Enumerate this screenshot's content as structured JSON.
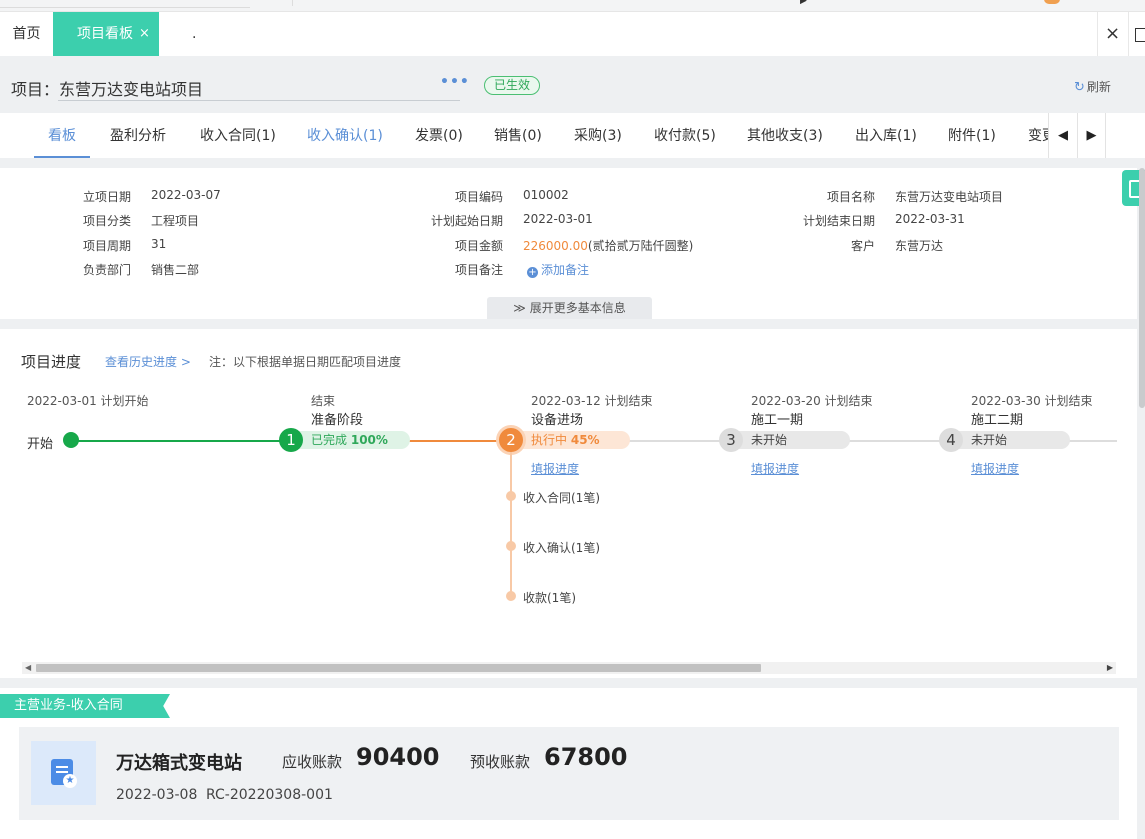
{
  "tabs": {
    "home": "首页",
    "active": "项目看板",
    "active_close": "×",
    "extra": ".",
    "close_all": "×"
  },
  "project": {
    "label": "项目：",
    "name": "东营万达变电站项目",
    "more": "•••",
    "status": "已生效",
    "refresh": "刷新"
  },
  "nav": {
    "items": [
      {
        "label": "看板"
      },
      {
        "label": "盈利分析"
      },
      {
        "label": "收入合同(1)"
      },
      {
        "label": "收入确认(1)"
      },
      {
        "label": "发票(0)"
      },
      {
        "label": "销售(0)"
      },
      {
        "label": "采购(3)"
      },
      {
        "label": "收付款(5)"
      },
      {
        "label": "其他收支(3)"
      },
      {
        "label": "出入库(1)"
      },
      {
        "label": "附件(1)"
      },
      {
        "label": "变更"
      }
    ]
  },
  "info": {
    "col1": [
      {
        "label": "立项日期",
        "value": "2022-03-07"
      },
      {
        "label": "项目分类",
        "value": "工程项目"
      },
      {
        "label": "项目周期",
        "value": "31"
      },
      {
        "label": "负责部门",
        "value": "销售二部"
      }
    ],
    "col2": [
      {
        "label": "项目编码",
        "value": "010002"
      },
      {
        "label": "计划起始日期",
        "value": "2022-03-01"
      },
      {
        "label": "项目金额",
        "value": "226000.00",
        "extra": "(贰拾贰万陆仟圆整)"
      },
      {
        "label": "项目备注",
        "value": "添加备注"
      }
    ],
    "col3": [
      {
        "label": "项目名称",
        "value": "东营万达变电站项目"
      },
      {
        "label": "计划结束日期",
        "value": "2022-03-31"
      },
      {
        "label": "客户",
        "value": "东营万达"
      }
    ],
    "expand": "展开更多基本信息"
  },
  "progress": {
    "title": "项目进度",
    "history_link": "查看历史进度 >",
    "note": "注：以下根据单据日期匹配项目进度",
    "start_date": "2022-03-01 计划开始",
    "start_label": "开始",
    "stages": [
      {
        "num": "1",
        "date": "结束",
        "name": "准备阶段",
        "status": "已完成",
        "percent": "100%",
        "fill": ""
      },
      {
        "num": "2",
        "date": "2022-03-12 计划结束",
        "name": "设备进场",
        "status": "执行中",
        "percent": "45%",
        "fill": "填报进度"
      },
      {
        "num": "3",
        "date": "2022-03-20 计划结束",
        "name": "施工一期",
        "status": "未开始",
        "percent": "",
        "fill": "填报进度"
      },
      {
        "num": "4",
        "date": "2022-03-30 计划结束",
        "name": "施工二期",
        "status": "未开始",
        "percent": "",
        "fill": "填报进度"
      }
    ],
    "sub_items": [
      "收入合同(1笔)",
      "收入确认(1笔)",
      "收款(1笔)"
    ]
  },
  "business": {
    "ribbon": "主营业务-收入合同",
    "name": "万达箱式变电站",
    "receivable_label": "应收账款",
    "receivable": "90400",
    "prepaid_label": "预收账款",
    "prepaid": "67800",
    "date": "2022-03-08",
    "code": "RC-20220308-001"
  },
  "colors": {
    "accent": "#3ccfad",
    "link": "#5b8fd6",
    "done": "#17a84a",
    "active": "#f08a3c",
    "pending": "#dddddd"
  }
}
